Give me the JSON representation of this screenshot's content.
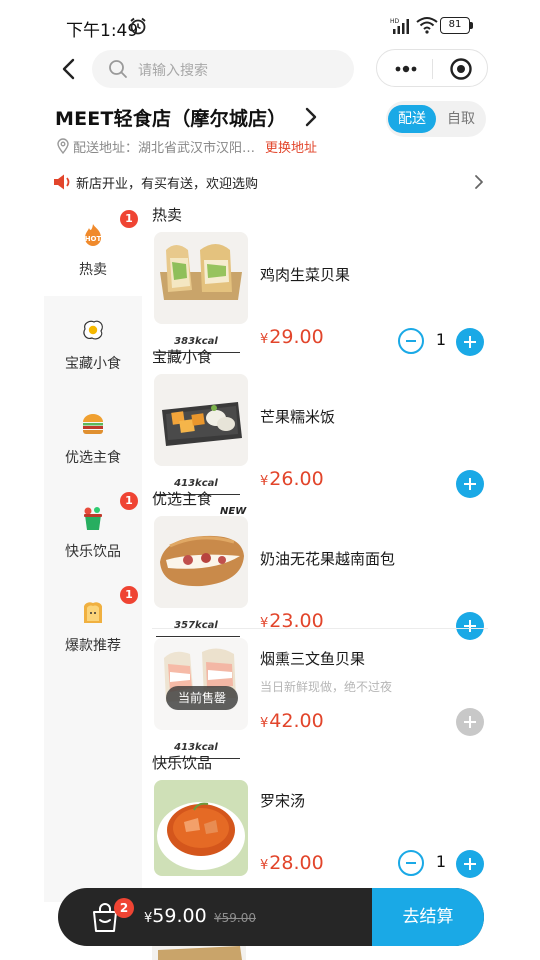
{
  "status_bar": {
    "time": "下午1:49",
    "battery": "81"
  },
  "search": {
    "placeholder": "请输入搜索"
  },
  "store": {
    "name": "MEET轻食店（摩尔城店）"
  },
  "delivery_mode": {
    "active": "配送",
    "inactive": "自取"
  },
  "address": {
    "label": "配送地址：",
    "value": "湖北省武汉市汉阳…",
    "change": "更换地址"
  },
  "notice": {
    "text": "新店开业，有买有送，欢迎选购"
  },
  "categories": [
    {
      "label": "热卖",
      "icon": "hot-icon",
      "badge": "1"
    },
    {
      "label": "宝藏小食",
      "icon": "egg-icon",
      "badge": ""
    },
    {
      "label": "优选主食",
      "icon": "burger-icon",
      "badge": ""
    },
    {
      "label": "快乐饮品",
      "icon": "drink-icon",
      "badge": "1"
    },
    {
      "label": "爆款推荐",
      "icon": "toast-icon",
      "badge": "1"
    }
  ],
  "sections": {
    "hot": "热卖",
    "snacks": "宝藏小食",
    "mains": "优选主食",
    "drinks": "快乐饮品"
  },
  "products": [
    {
      "name": "鸡肉生菜贝果",
      "currency": "¥",
      "price": "29.00",
      "kcal": "383kcal",
      "quantity": "1"
    },
    {
      "name": "芒果糯米饭",
      "currency": "¥",
      "price": "26.00",
      "kcal": "413kcal"
    },
    {
      "name": "奶油无花果越南面包",
      "currency": "¥",
      "price": "23.00",
      "kcal": "357kcal",
      "tag": "NEW"
    },
    {
      "name": "烟熏三文鱼贝果",
      "currency": "¥",
      "price": "42.00",
      "kcal": "413kcal",
      "desc": "当日新鲜现做，绝不过夜",
      "status": "当前售罄"
    },
    {
      "name": "罗宋汤",
      "currency": "¥",
      "price": "28.00",
      "quantity": "1"
    }
  ],
  "cart": {
    "count": "2",
    "currency": "¥",
    "total": "59.00",
    "original": "¥59.00",
    "checkout": "去结算"
  },
  "colors": {
    "accent": "#1aa9e6",
    "price": "#e2452b",
    "badge": "#ef4433",
    "cart_bar": "#262626"
  }
}
